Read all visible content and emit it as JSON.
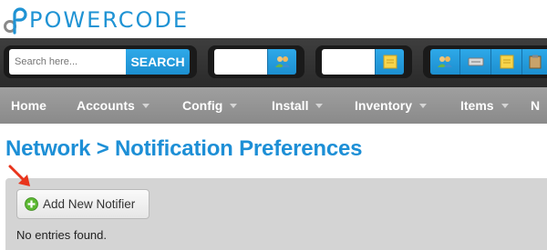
{
  "brand": {
    "name": "POWERCODE"
  },
  "toolbar": {
    "search_placeholder": "Search here...",
    "search_button": "SEARCH",
    "icons": [
      "user-group-icon",
      "sticky-note-icon",
      "user-group-icon",
      "server-icon",
      "sticky-note-icon",
      "clipboard-icon"
    ]
  },
  "nav": {
    "items": [
      {
        "label": "Home",
        "has_dropdown": false
      },
      {
        "label": "Accounts",
        "has_dropdown": true
      },
      {
        "label": "Config",
        "has_dropdown": true
      },
      {
        "label": "Install",
        "has_dropdown": true
      },
      {
        "label": "Inventory",
        "has_dropdown": true
      },
      {
        "label": "Items",
        "has_dropdown": true
      },
      {
        "label": "N",
        "has_dropdown": false
      }
    ]
  },
  "page": {
    "title": "Network > Notification Preferences",
    "add_button": "Add New Notifier",
    "empty_message": "No entries found."
  },
  "colors": {
    "brand_blue": "#1f93d4",
    "title_blue": "#1d8fd6",
    "toolbar_bg": "#333333",
    "nav_bg": "#959595",
    "panel_bg": "#d4d4d4",
    "annotation_red": "#e8341c"
  }
}
